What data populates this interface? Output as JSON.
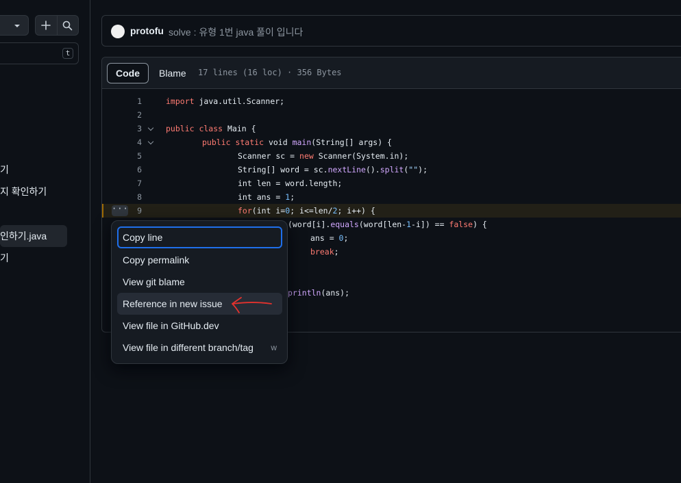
{
  "sidebar": {
    "filter_shortcut": "t",
    "items": [
      {
        "label": "기"
      },
      {
        "label": "지 확인하기"
      },
      {
        "label": "인하기.java"
      },
      {
        "label": "기"
      }
    ]
  },
  "commit": {
    "author": "protofu",
    "message": "solve : 유형 1번 java 풀이 입니다"
  },
  "file": {
    "tab_code": "Code",
    "tab_blame": "Blame",
    "info": "17 lines (16 loc) · 356 Bytes",
    "more_dots": "···"
  },
  "code": {
    "line_numbers": [
      "1",
      "2",
      "3",
      "4",
      "5",
      "6",
      "7",
      "8",
      "9"
    ],
    "l1_kw": "import",
    "l1_rest": " java.util.Scanner;",
    "l3_kw": "public class",
    "l3_rest": " Main {",
    "l4_kw": "public static",
    "l4_void": " void ",
    "l4_fn": "main",
    "l4_rest": "(String[] args) {",
    "l5_a": "Scanner sc = ",
    "l5_kw": "new",
    "l5_b": " Scanner(System.in);",
    "l6_a": "String[] word = sc.",
    "l6_fn": "nextLine",
    "l6_b": "().",
    "l6_fn2": "split",
    "l6_c": "(",
    "l6_str": "\"\"",
    "l6_d": ");",
    "l7": "int len = word.length;",
    "l8_a": "int ans = ",
    "l8_num": "1",
    "l8_b": ";",
    "l9_kw": "for",
    "l9_a": "(int i=",
    "l9_n0": "0",
    "l9_b": "; i<=len/",
    "l9_n2": "2",
    "l9_c": "; i++) {",
    "l10_a": "(word[i].",
    "l10_fn": "equals",
    "l10_b": "(word[len-",
    "l10_n1": "1",
    "l10_c": "-i]) == ",
    "l10_kw": "false",
    "l10_d": ") {",
    "l11_a": "ans = ",
    "l11_num": "0",
    "l11_b": ";",
    "l12_kw": "break",
    "l12_b": ";",
    "l15_fn": "println",
    "l15_b": "(ans);"
  },
  "menu": {
    "items": [
      {
        "label": "Copy line"
      },
      {
        "label": "Copy permalink"
      },
      {
        "label": "View git blame"
      },
      {
        "label": "Reference in new issue"
      },
      {
        "label": "View file in GitHub.dev"
      },
      {
        "label": "View file in different branch/tag",
        "shortcut": "w"
      }
    ]
  },
  "colors": {
    "background": "#0d1117",
    "border": "#30363d",
    "focus_ring": "#1f6feb",
    "annotation_arrow": "#e5322d"
  }
}
